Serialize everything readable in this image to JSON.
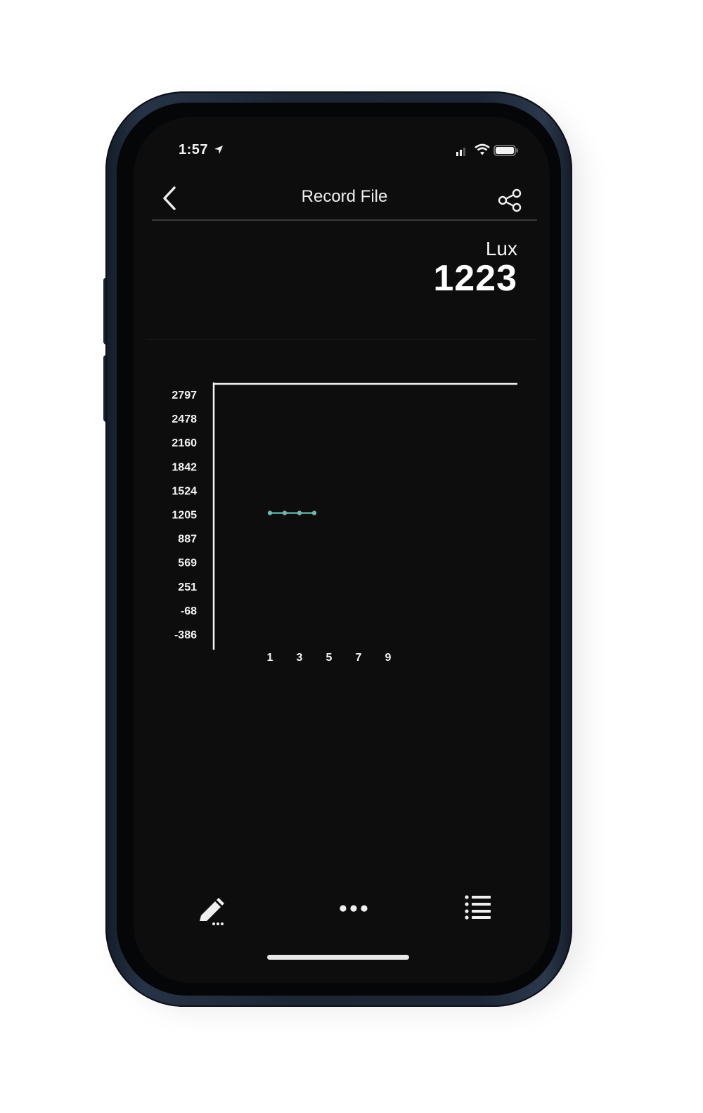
{
  "status_bar": {
    "time": "1:57",
    "icons": [
      "location-arrow-icon",
      "cellular-signal-icon",
      "wifi-icon",
      "battery-icon"
    ]
  },
  "nav": {
    "back_icon": "chevron-left-icon",
    "title": "Record File",
    "share_icon": "share-icon"
  },
  "reading": {
    "unit": "Lux",
    "value": "1223"
  },
  "chart_data": {
    "type": "line",
    "title": "",
    "xlabel": "",
    "ylabel": "",
    "y_ticks": [
      "2797",
      "2478",
      "2160",
      "1842",
      "1524",
      "1205",
      "887",
      "569",
      "251",
      "-68",
      "-386"
    ],
    "x_ticks": [
      "1",
      "3",
      "5",
      "7",
      "9"
    ],
    "x": [
      1,
      2,
      3,
      4
    ],
    "values": [
      1223,
      1223,
      1223,
      1223
    ],
    "ylim": [
      -386,
      2797
    ],
    "xlim": [
      1,
      9
    ],
    "line_color": "#6fb6ad",
    "grid": false
  },
  "toolbar": {
    "edit_icon": "edit-pencil-icon",
    "more_icon": "more-dots-icon",
    "list_icon": "list-icon"
  },
  "colors": {
    "screen_bg": "#0d0d0e",
    "text": "#f0f0f0",
    "accent": "#6fb6ad"
  }
}
